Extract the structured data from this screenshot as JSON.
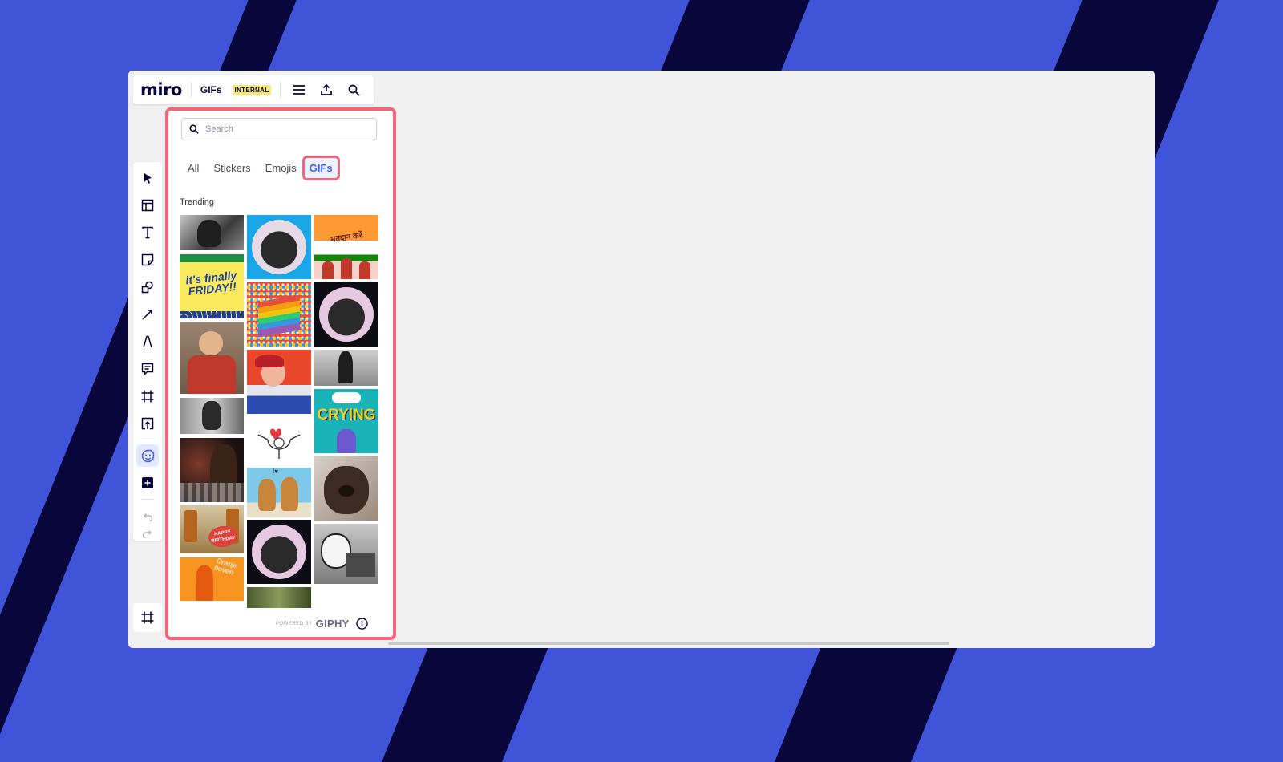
{
  "app": {
    "logo": "miro",
    "board_name": "GIFs",
    "badge": "INTERNAL"
  },
  "topbar_icons": [
    "menu-icon",
    "share-upload-icon",
    "search-icon"
  ],
  "toolbar": {
    "tools": [
      "select-cursor-icon",
      "templates-icon",
      "text-icon",
      "sticky-note-icon",
      "shapes-icon",
      "line-arrow-icon",
      "pen-icon",
      "comment-icon",
      "frame-icon",
      "upload-icon",
      "stickers-gifs-icon",
      "more-apps-icon"
    ],
    "active_tool": "stickers-gifs-icon",
    "undo_icon": "undo-icon",
    "redo_icon": "redo-icon",
    "frames_icon": "frames-panel-icon"
  },
  "panel": {
    "search_placeholder": "Search",
    "tabs": [
      {
        "label": "All"
      },
      {
        "label": "Stickers"
      },
      {
        "label": "Emojis"
      },
      {
        "label": "GIFs",
        "active": true
      }
    ],
    "section_title": "Trending",
    "gif_texts": {
      "friday": "it's finally FRIDAY!!",
      "flag": "मतदान करें",
      "crying": "CRYING",
      "birthday": "HAPPY BIRTHDAY",
      "oranje": "Oranje boven",
      "bears": "I♥"
    },
    "footer": {
      "powered_by": "POWERED BY",
      "brand": "GIPHY",
      "info_icon": "info-icon"
    }
  },
  "colors": {
    "accent": "#4262ff",
    "highlight": "#f2657a",
    "background": "#3f54d8",
    "stripe": "#08063a"
  }
}
